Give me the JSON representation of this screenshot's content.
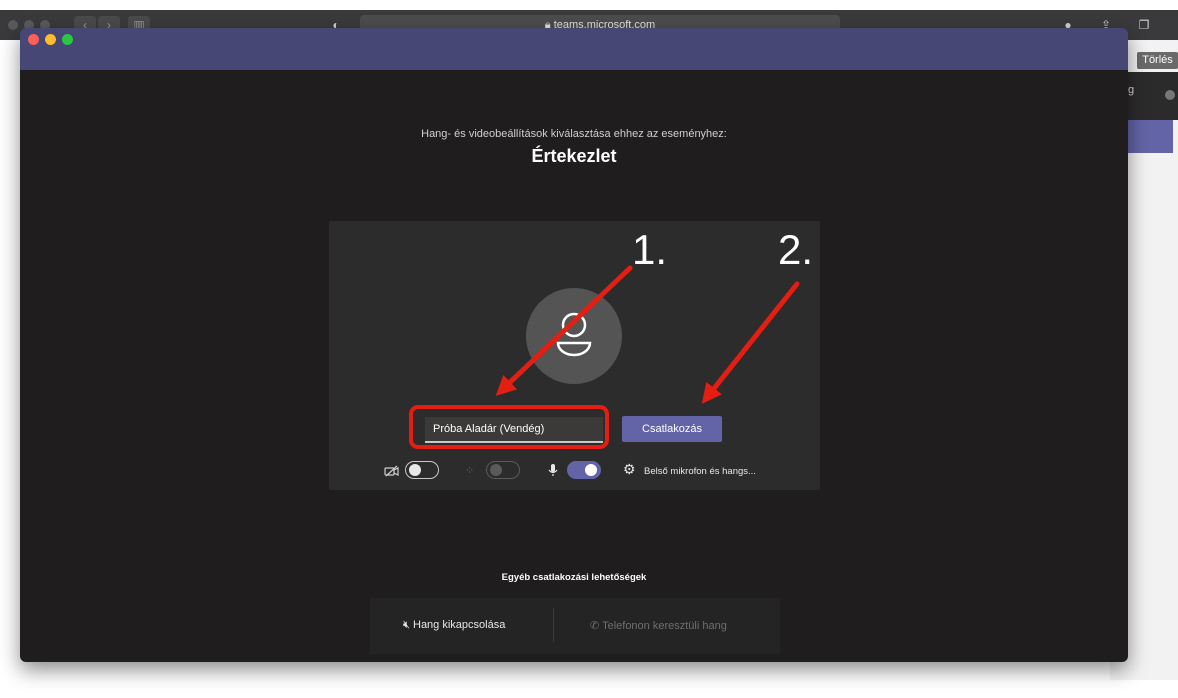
{
  "browser": {
    "url": "teams.microsoft.com",
    "back_icon": "chevron-left-icon",
    "forward_icon": "chevron-right-icon"
  },
  "background": {
    "delete_button": "Törlés",
    "partial_text": "g"
  },
  "prejoin": {
    "subtitle": "Hang- és videobeállítások kiválasztása ehhez az eseményhez:",
    "meeting_title": "Értekezlet",
    "name_input_value": "Próba Aladár (Vendég)",
    "join_button": "Csatlakozás",
    "video_on": false,
    "blur_on": false,
    "mic_on": true,
    "audio_device": "Belső mikrofon és hangs..."
  },
  "annotations": {
    "step1": "1.",
    "step2": "2.",
    "color": "#e41e12"
  },
  "other_options": {
    "title": "Egyéb csatlakozási lehetőségek",
    "audio_off": "Hang kikapcsolása",
    "phone_audio": "Telefonon keresztüli hang"
  },
  "colors": {
    "teams_purple": "#6264a7",
    "titlebar": "#464775",
    "window_bg": "#1f1d1e"
  }
}
